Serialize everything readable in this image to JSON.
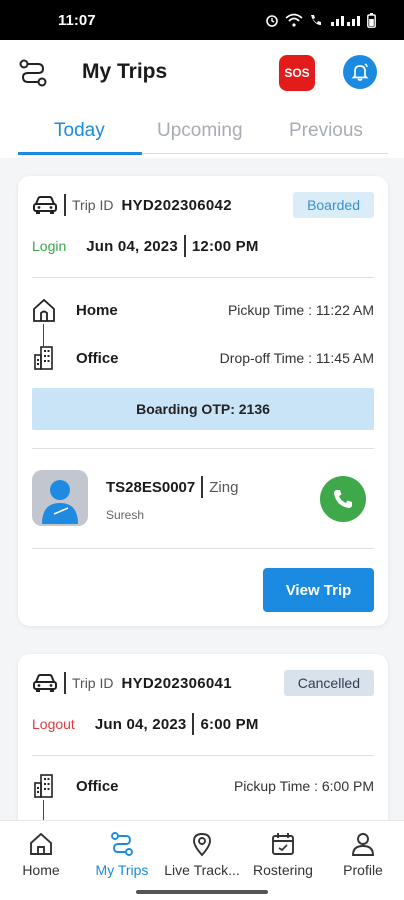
{
  "status_bar": {
    "time": "11:07"
  },
  "app_bar": {
    "title": "My Trips",
    "sos_label": "SOS"
  },
  "tabs": [
    {
      "label": "Today",
      "active": true
    },
    {
      "label": "Upcoming",
      "active": false
    },
    {
      "label": "Previous",
      "active": false
    }
  ],
  "trips": [
    {
      "trip_id_label": "Trip ID",
      "trip_id": "HYD202306042",
      "status": "Boarded",
      "direction": "Login",
      "date": "Jun 04, 2023",
      "time": "12:00 PM",
      "pickup_name": "Home",
      "pickup_time": "Pickup Time : 11:22 AM",
      "drop_name": "Office",
      "drop_time": "Drop-off Time : 11:45 AM",
      "otp": "Boarding OTP: 2136",
      "vehicle_no": "TS28ES0007",
      "vehicle_type": "Zing",
      "driver_name": "Suresh",
      "view_label": "View Trip"
    },
    {
      "trip_id_label": "Trip ID",
      "trip_id": "HYD202306041",
      "status": "Cancelled",
      "direction": "Logout",
      "date": "Jun 04, 2023",
      "time": "6:00 PM",
      "pickup_name": "Office",
      "pickup_time": "Pickup Time : 6:00 PM"
    }
  ],
  "bottom_nav": [
    {
      "label": "Home",
      "icon": "home-icon",
      "active": false
    },
    {
      "label": "My Trips",
      "icon": "route-icon",
      "active": true
    },
    {
      "label": "Live Track...",
      "icon": "location-pin-icon",
      "active": false
    },
    {
      "label": "Rostering",
      "icon": "calendar-icon",
      "active": false
    },
    {
      "label": "Profile",
      "icon": "person-icon",
      "active": false
    }
  ],
  "colors": {
    "accent": "#1a8be0",
    "sos": "#e31b1b",
    "call": "#3ea84a",
    "login": "#3aa64a",
    "logout": "#e23b3b"
  }
}
